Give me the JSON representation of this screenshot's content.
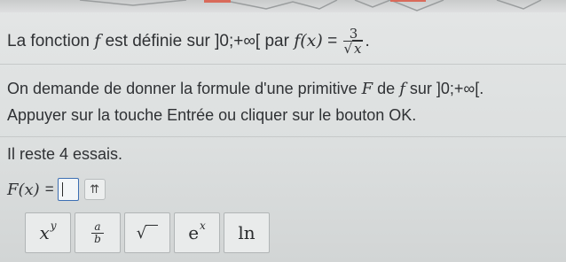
{
  "statement": {
    "prefix": "La fonction ",
    "f_symbol": "f",
    "middle": " est définie sur ",
    "domain": "]0;+∞[",
    "par": " par ",
    "fx": "f(x)",
    "equals": " = ",
    "numerator": "3",
    "radicand": "x",
    "end": "."
  },
  "instruction": {
    "text_before": "On demande de donner la formule d'une primitive ",
    "F_symbol": "F",
    "text_de": " de ",
    "f_symbol": "f",
    "text_sur": " sur ",
    "domain": "]0;+∞[."
  },
  "hint": "Appuyer sur la touche Entrée ou cliquer sur le bouton OK.",
  "attempts": "Il reste 4 essais.",
  "answer": {
    "label": "F(x)",
    "equals": "=",
    "value": "",
    "history_icon": "⇈"
  },
  "keypad": [
    {
      "name": "power",
      "base": "x",
      "sup": "y"
    },
    {
      "name": "fraction",
      "num": "a",
      "den": "b"
    },
    {
      "name": "sqrt",
      "symbol": "√"
    },
    {
      "name": "exp",
      "base": "e",
      "sup": "x"
    },
    {
      "name": "ln",
      "label": "ln"
    }
  ]
}
